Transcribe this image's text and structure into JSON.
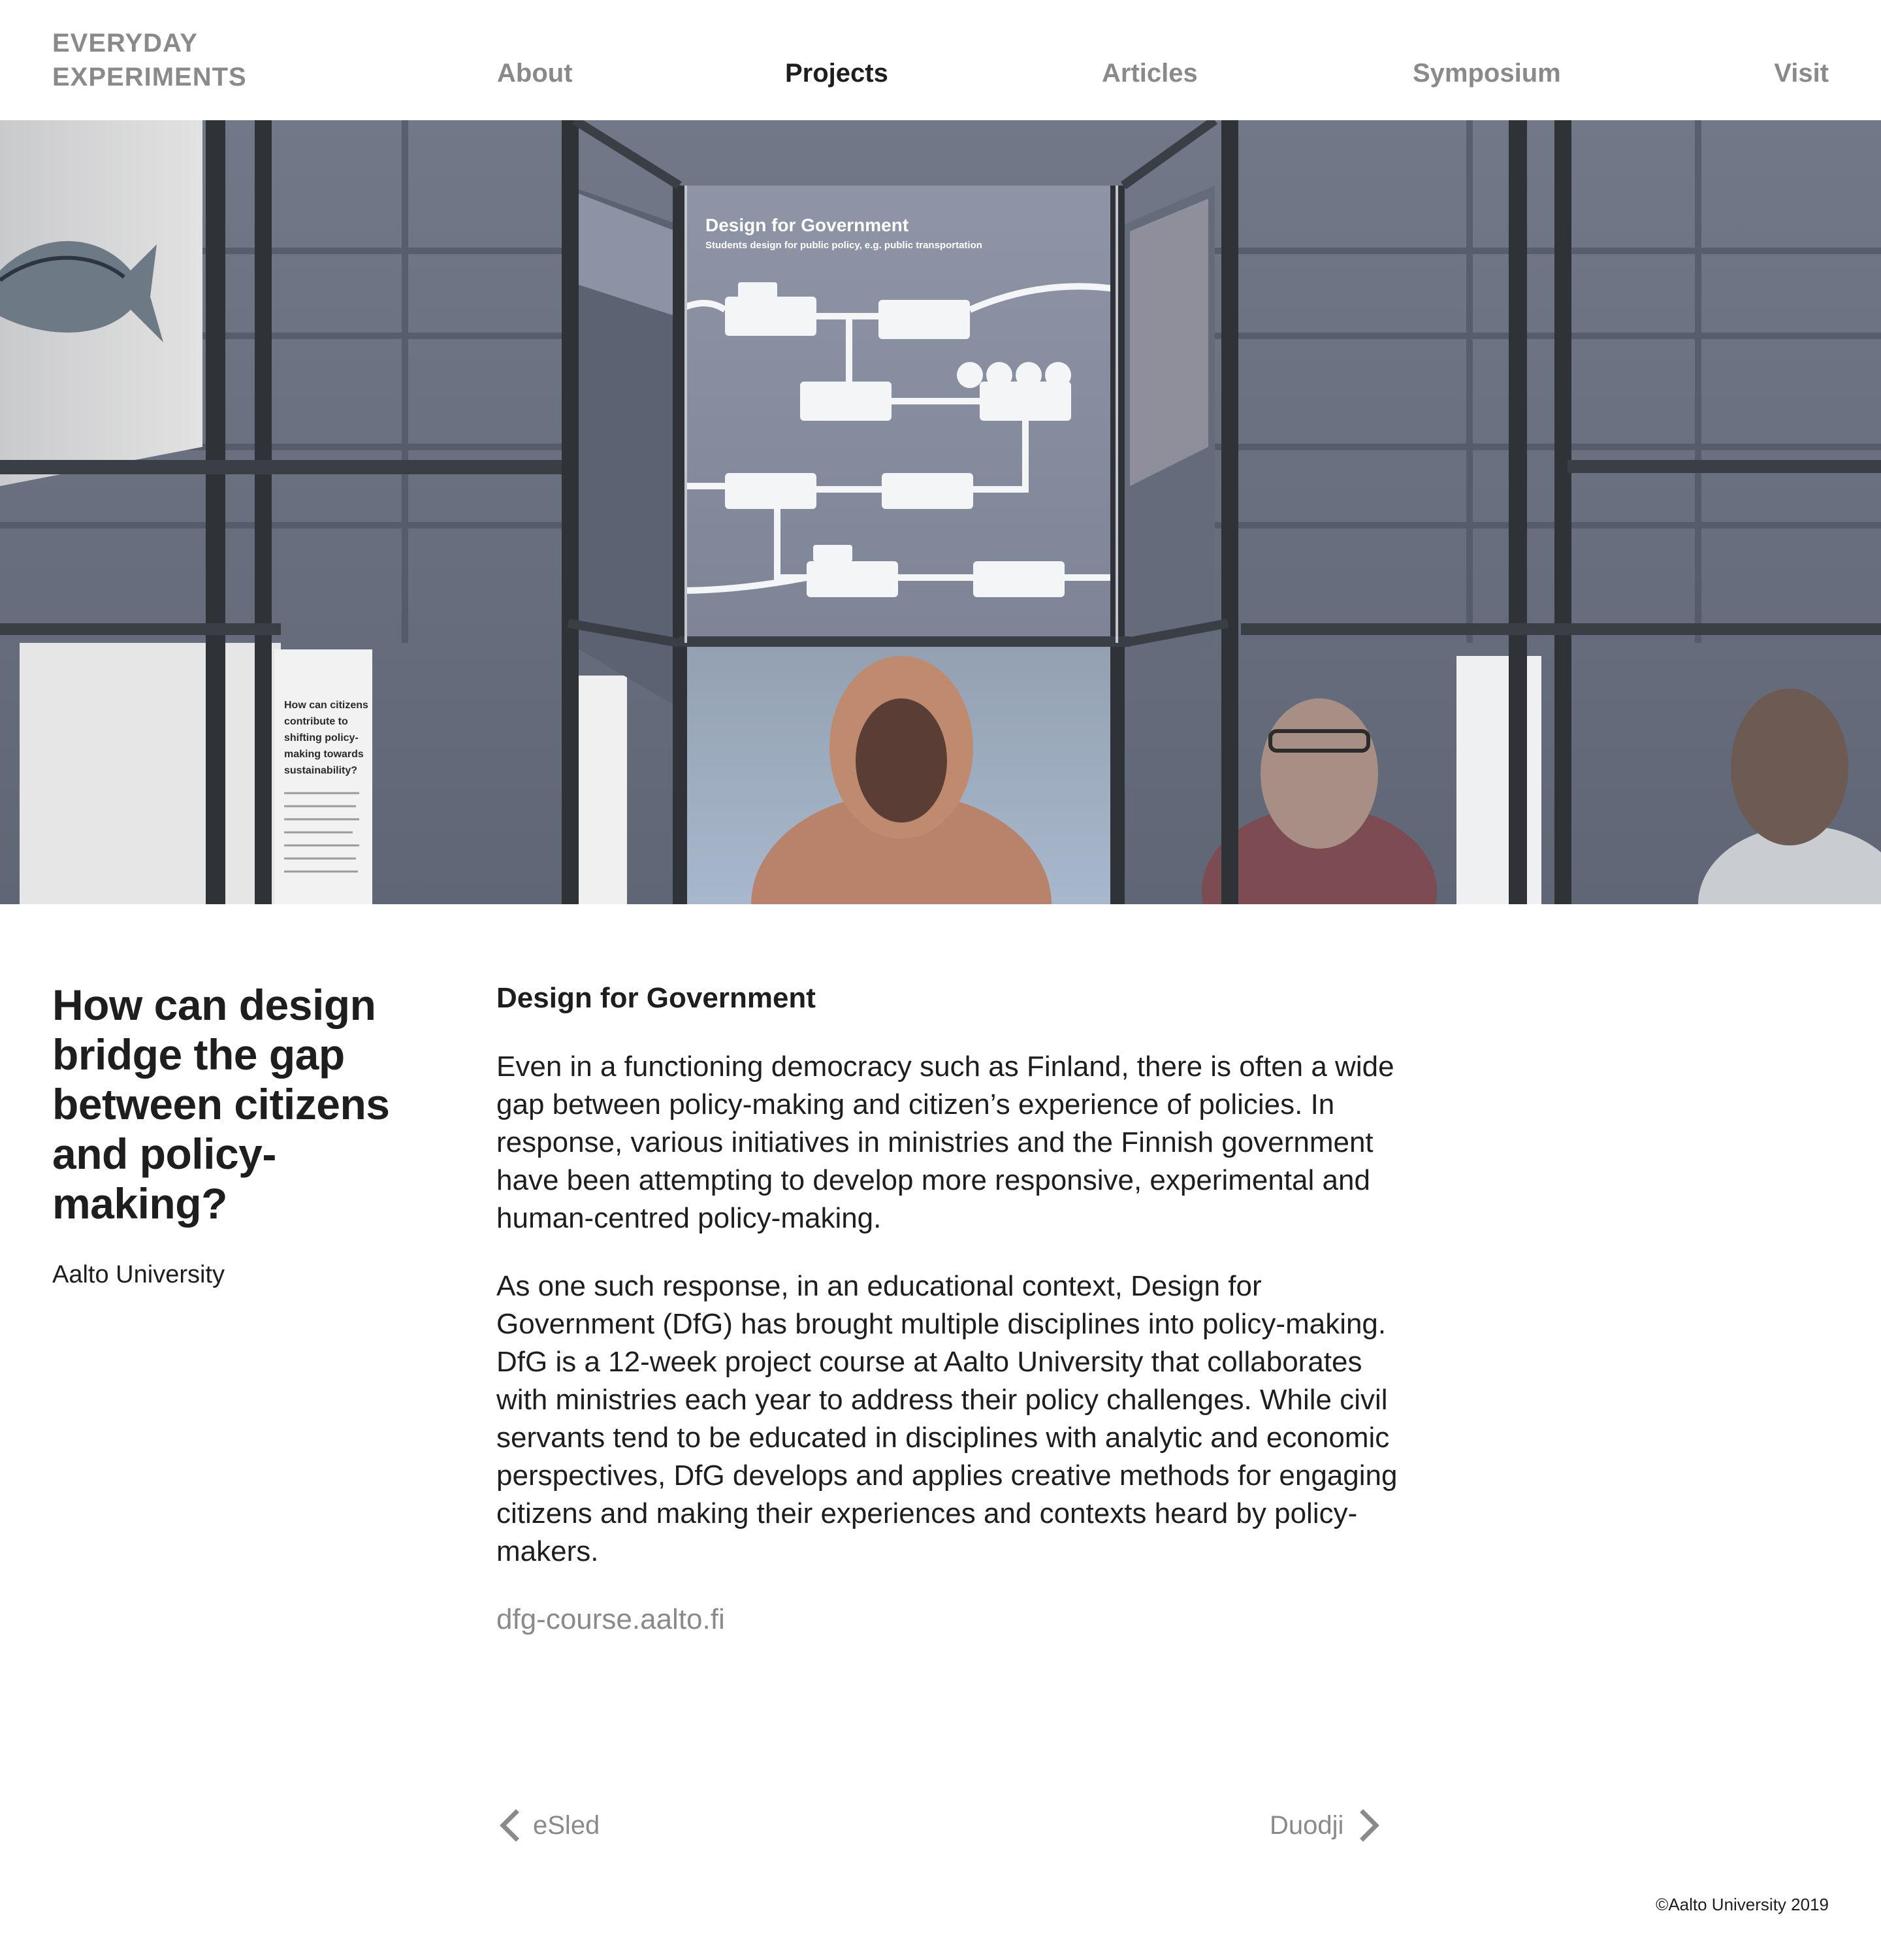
{
  "header": {
    "logo_line1": "EVERYDAY",
    "logo_line2": "EXPERIMENTS",
    "nav": {
      "about": "About",
      "projects": "Projects",
      "articles": "Articles",
      "symposium": "Symposium",
      "visit": "Visit"
    },
    "active_nav": "Projects"
  },
  "hero": {
    "panel_title": "Design for Government",
    "panel_subtitle": "Students design for public policy, e.g. public transportation",
    "side_text_lines": [
      "How can citizens",
      "contribute to",
      "shifting policy-",
      "making towards",
      "sustainability?"
    ]
  },
  "side": {
    "question": "How can design bridge the gap between citizens and policy-making?",
    "organization": "Aalto University"
  },
  "main": {
    "title": "Design for Government",
    "paragraph_1": "Even in a functioning democracy such as Finland, there is often a wide gap between policy-making and citizen’s experience of policies. In response, various initiatives in ministries and the Finnish government have been attempting to develop more responsive, experimental and human-centred policy-making.",
    "paragraph_2": "As one such response, in an educational context, Design for Government (DfG) has brought multiple disciplines into policy-making. DfG is a 12-week project course at Aalto University that collaborates with ministries each year to address their policy challenges. While civil servants tend to be educated in disciplines with analytic and economic perspectives, DfG develops and applies creative methods for engaging citizens and making their experiences and contexts heard by policy-makers.",
    "link": "dfg-course.aalto.fi"
  },
  "pager": {
    "prev_label": "eSled",
    "next_label": "Duodji"
  },
  "footer": {
    "copyright": "©Aalto University 2019"
  },
  "colors": {
    "text": "#1e1e1e",
    "muted": "#8a8a8a",
    "background": "#ffffff"
  }
}
